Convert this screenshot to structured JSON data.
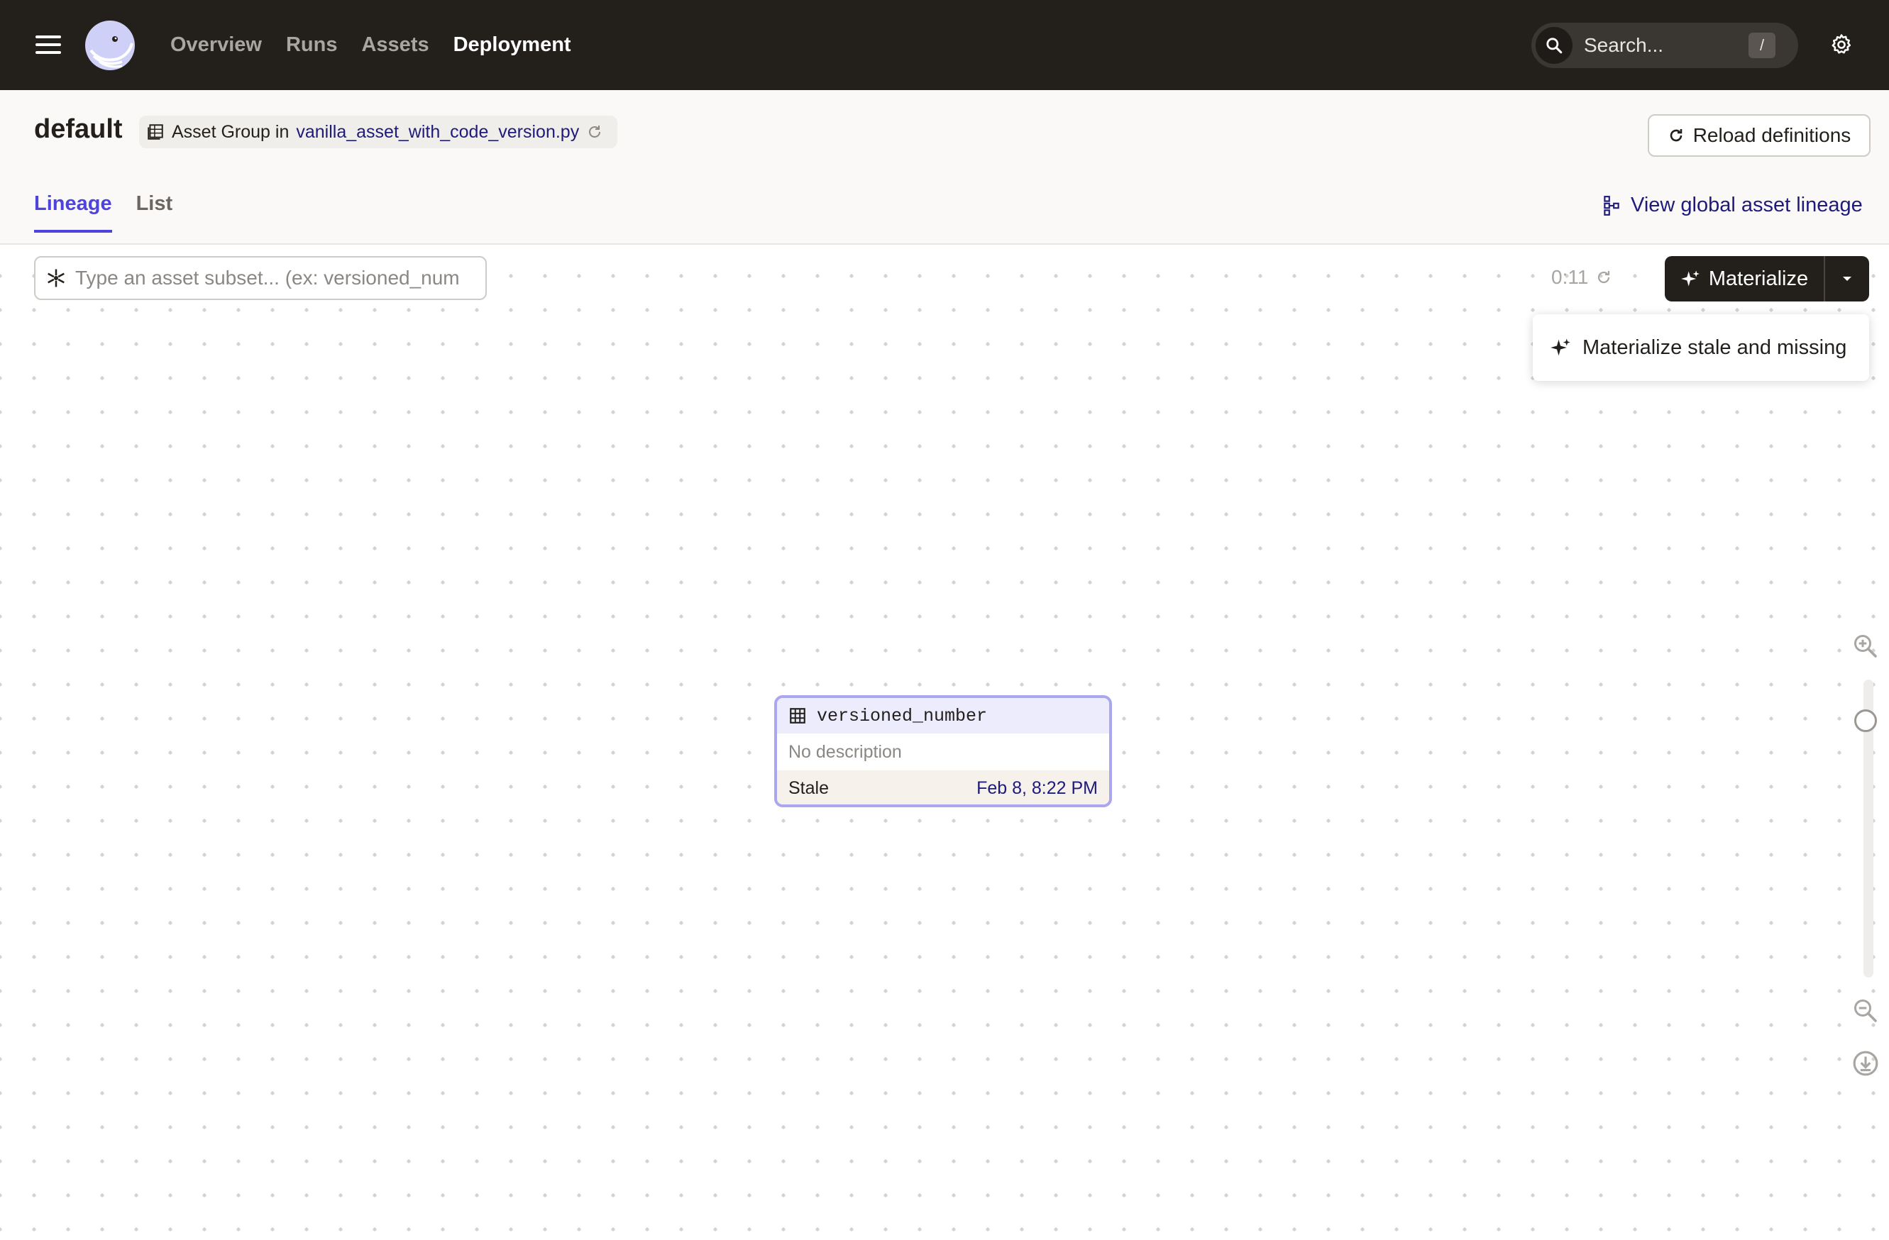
{
  "topnav": {
    "items": [
      {
        "label": "Overview",
        "active": false
      },
      {
        "label": "Runs",
        "active": false
      },
      {
        "label": "Assets",
        "active": false
      },
      {
        "label": "Deployment",
        "active": true
      }
    ],
    "search_placeholder": "Search...",
    "search_shortcut": "/"
  },
  "header": {
    "title": "default",
    "group_prefix": "Asset Group in",
    "group_file": "vanilla_asset_with_code_version.py",
    "reload_label": "Reload definitions"
  },
  "tabs": [
    {
      "label": "Lineage",
      "active": true
    },
    {
      "label": "List",
      "active": false
    }
  ],
  "global_lineage_label": "View global asset lineage",
  "toolbar": {
    "subset_placeholder": "Type an asset subset... (ex: versioned_num",
    "timer": "0:11",
    "materialize_label": "Materialize",
    "dropdown_item": "Materialize stale and missing"
  },
  "asset": {
    "name": "versioned_number",
    "description": "No description",
    "status": "Stale",
    "timestamp": "Feb 8, 8:22 PM"
  },
  "colors": {
    "topbar": "#231f1b",
    "accent": "#4f43dd",
    "link": "#1e1b7a",
    "node_border": "#aaa6ef",
    "node_header": "#ececfc",
    "node_status_bg": "#f6f1ea"
  }
}
